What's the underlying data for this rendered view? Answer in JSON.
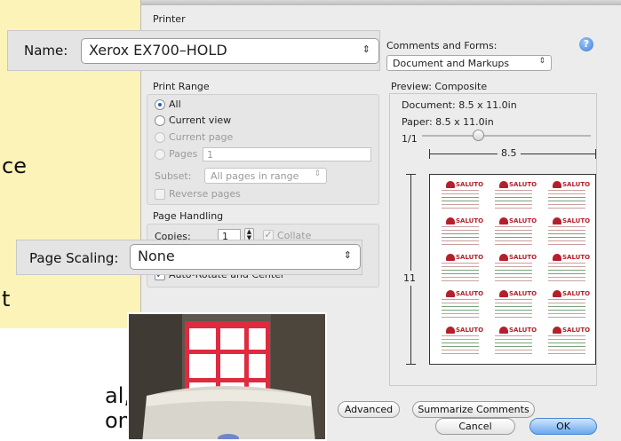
{
  "background_text": {
    "frag1": "ce",
    "frag2": "t",
    "frag3": "al,",
    "frag4": "om."
  },
  "dialog": {
    "printer_header": "Printer",
    "comments_forms_label": "Comments and Forms:",
    "comments_forms_value": "Document and Markups",
    "help_icon": "question-icon",
    "print_range": {
      "header": "Print Range",
      "options": [
        {
          "label": "All",
          "selected": true,
          "enabled": true
        },
        {
          "label": "Current view",
          "selected": false,
          "enabled": true
        },
        {
          "label": "Current page",
          "selected": false,
          "enabled": false
        },
        {
          "label": "Pages",
          "selected": false,
          "enabled": false
        }
      ],
      "pages_value": "1",
      "subset_label": "Subset:",
      "subset_value": "All pages in range",
      "reverse_pages_label": "Reverse pages"
    },
    "page_handling": {
      "header": "Page Handling",
      "copies_label": "Copies:",
      "copies_value": "1",
      "collate_label": "Collate",
      "auto_rotate_label": "Auto-Rotate and Center"
    },
    "preview": {
      "header": "Preview: Composite",
      "document_size": "Document: 8.5 x 11.0in",
      "paper_size": "Paper: 8.5 x 11.0in",
      "page_count": "1/1",
      "width_label": "8.5",
      "height_label": "11",
      "label_brand": "SALUTO"
    },
    "buttons": {
      "advanced": "Advanced",
      "summarize": "Summarize Comments",
      "cancel": "Cancel",
      "ok": "OK"
    }
  },
  "callouts": {
    "name_label": "Name:",
    "name_value": "Xerox EX700–HOLD",
    "page_scaling_label": "Page Scaling:",
    "page_scaling_value": "None"
  },
  "colors": {
    "accent": "#1e5fbf",
    "label_red": "#b3202c",
    "background_yellow": "#fbf3b8"
  }
}
